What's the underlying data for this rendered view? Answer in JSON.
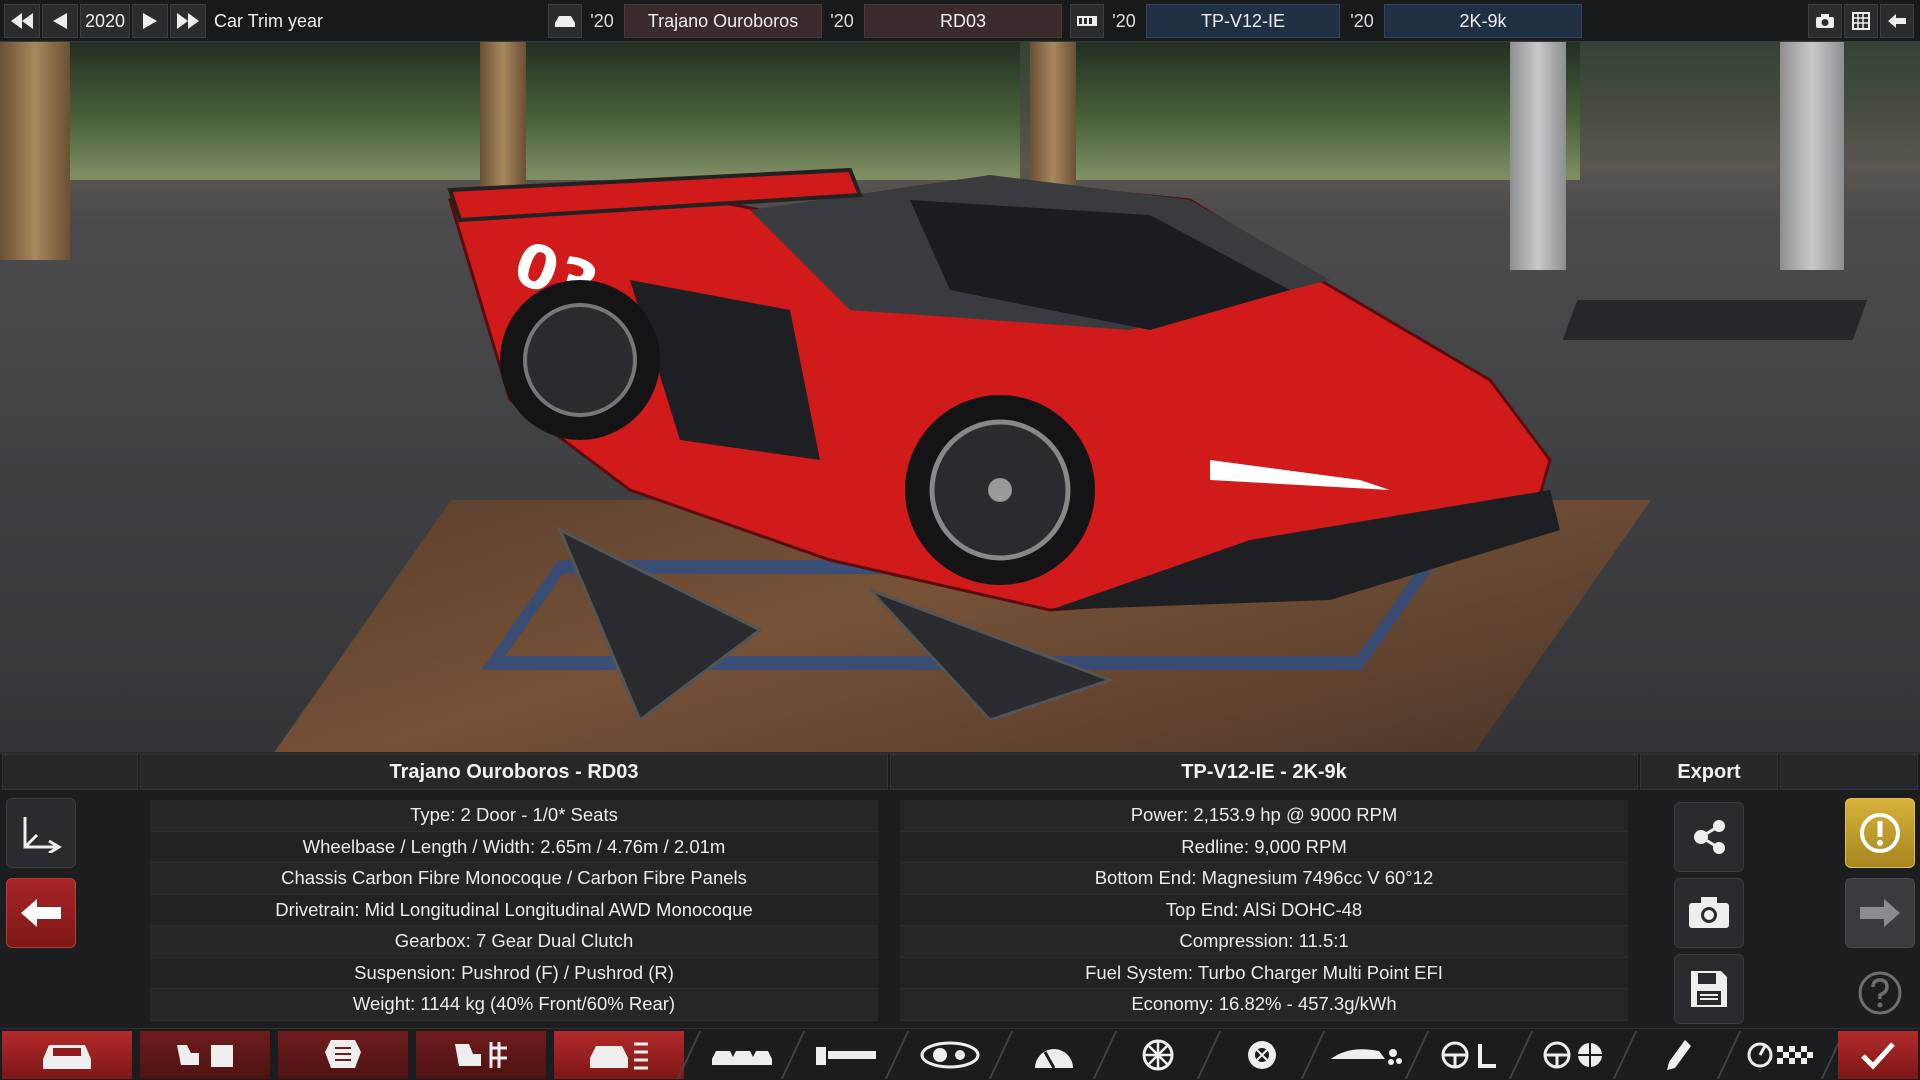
{
  "topbar": {
    "year": "2020",
    "trim_year_label": "Car Trim year",
    "model_year_tag": "'20",
    "model_name": "Trajano Ouroboros",
    "trim_year_tag": "'20",
    "trim_name": "RD03",
    "engine_family_year_tag": "'20",
    "engine_family": "TP-V12-IE",
    "engine_variant_year_tag": "'20",
    "engine_variant": "2K-9k"
  },
  "car_panel": {
    "title": "Trajano Ouroboros - RD03",
    "rows": [
      "Type: 2 Door - 1/0* Seats",
      "Wheelbase / Length / Width: 2.65m / 4.76m / 2.01m",
      "Chassis Carbon Fibre Monocoque / Carbon Fibre Panels",
      "Drivetrain: Mid Longitudinal Longitudinal AWD Monocoque",
      "Gearbox: 7 Gear Dual Clutch",
      "Suspension: Pushrod (F) / Pushrod (R)",
      "Weight: 1144 kg (40% Front/60% Rear)"
    ]
  },
  "engine_panel": {
    "title": "TP-V12-IE - 2K-9k",
    "rows": [
      "Power: 2,153.9 hp @ 9000 RPM",
      "Redline:  9,000 RPM",
      "Bottom End: Magnesium 7496cc V 60°12",
      "Top End: AlSi DOHC-48",
      "Compression: 11.5:1",
      "Fuel System: Turbo Charger Multi Point EFI",
      "Economy: 16.82% - 457.3g/kWh"
    ]
  },
  "export_panel": {
    "title": "Export"
  },
  "colors": {
    "accent_red": "#a82525",
    "warning_yellow": "#d6b23a",
    "engine_field_blue": "#1f3044",
    "car_field_red": "#3b2a2b"
  },
  "icons": {
    "topbar_left": [
      "skip-back-icon",
      "step-back-icon",
      "play-icon",
      "fast-forward-icon"
    ],
    "topbar_right": [
      "camera-icon",
      "grid-icon",
      "back-arrow-icon"
    ],
    "left_side": [
      "resize-corner-icon",
      "arrow-left-icon"
    ],
    "export": [
      "share-icon",
      "camera-icon",
      "save-icon"
    ],
    "right_side": [
      "warning-icon",
      "arrow-right-icon",
      "help-icon"
    ],
    "navbar": [
      "car-body-icon",
      "engine-block-icon",
      "engine-icon",
      "engine-tune-icon",
      "car-trim-icon",
      "cars-icon",
      "chassis-icon",
      "headlight-icon",
      "gauge-icon",
      "wheel-icon",
      "tire-icon",
      "aero-icon",
      "steering-icon",
      "safety-icon",
      "paint-icon",
      "speed-test-icon",
      "confirm-check-icon"
    ]
  }
}
